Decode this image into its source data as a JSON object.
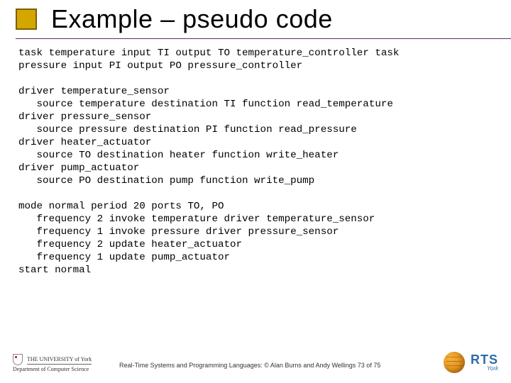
{
  "title": "Example – pseudo code",
  "code": "task temperature input TI output TO temperature_controller task\npressure input PI output PO pressure_controller\n\ndriver temperature_sensor\n   source temperature destination TI function read_temperature\ndriver pressure_sensor\n   source pressure destination PI function read_pressure\ndriver heater_actuator\n   source TO destination heater function write_heater\ndriver pump_actuator\n   source PO destination pump function write_pump\n\nmode normal period 20 ports TO, PO\n   frequency 2 invoke temperature driver temperature_sensor\n   frequency 1 invoke pressure driver pressure_sensor\n   frequency 2 update heater_actuator\n   frequency 1 update pump_actuator\nstart normal",
  "footer": {
    "uni_line1": "THE UNIVERSITY of York",
    "uni_line2": "Department of Computer Science",
    "caption": "Real-Time Systems and Programming Languages: © Alan Burns and Andy Wellings 73 of 75",
    "rts_big": "RTS",
    "rts_small": "York"
  }
}
